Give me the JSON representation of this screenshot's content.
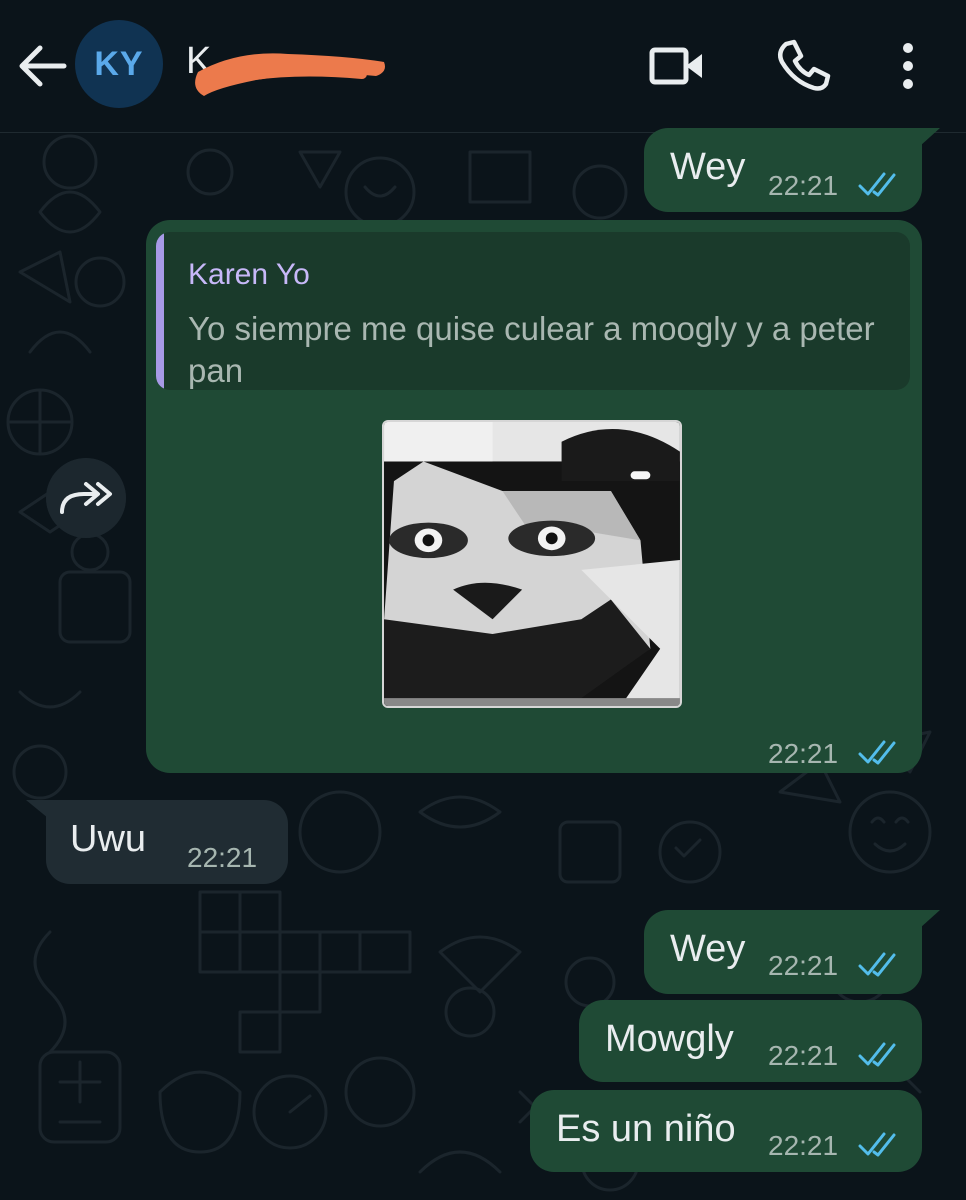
{
  "header": {
    "avatar_initials": "KY",
    "contact_name": "K",
    "icons": [
      "back-arrow-icon",
      "video-camera-icon",
      "phone-icon",
      "more-vertical-icon"
    ]
  },
  "messages": [
    {
      "direction": "out",
      "text": "Wey",
      "time": "22:21",
      "status": "read"
    },
    {
      "direction": "out",
      "type": "sticker-reply",
      "reply_to": {
        "author": "Karen Yo",
        "text": "Yo siempre me quise culear a moogly y a peter pan"
      },
      "sticker": "cat-face-sticker",
      "time": "22:21",
      "status": "read"
    },
    {
      "direction": "in",
      "text": "Uwu",
      "time": "22:21"
    },
    {
      "direction": "out",
      "text": "Wey",
      "time": "22:21",
      "status": "read"
    },
    {
      "direction": "out",
      "text": "Mowgly",
      "time": "22:21",
      "status": "read"
    },
    {
      "direction": "out",
      "text": "Es un niño",
      "time": "22:21",
      "status": "read"
    }
  ],
  "colors": {
    "background": "#0b141a",
    "outgoing_bubble": "#1f4a35",
    "incoming_bubble": "#202c33",
    "read_ticks": "#53bdeb",
    "quote_accent": "#a79ae6",
    "redaction": "#ec7a4c"
  }
}
